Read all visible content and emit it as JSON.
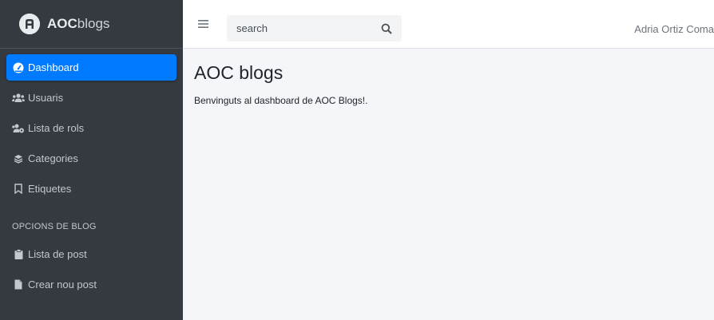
{
  "brand": {
    "bold": "AOC",
    "light": "blogs"
  },
  "sidebar": {
    "items": [
      {
        "label": "Dashboard",
        "icon": "tachometer-icon",
        "active": true
      },
      {
        "label": "Usuaris",
        "icon": "users-icon"
      },
      {
        "label": "Lista de rols",
        "icon": "users-cog-icon"
      },
      {
        "label": "Categories",
        "icon": "layers-icon"
      },
      {
        "label": "Etiquetes",
        "icon": "bookmark-icon"
      }
    ],
    "header": "OPCIONS DE BLOG",
    "blog_items": [
      {
        "label": "Lista de post",
        "icon": "clipboard-icon"
      },
      {
        "label": "Crear nou post",
        "icon": "file-icon"
      }
    ]
  },
  "topbar": {
    "search_placeholder": "search",
    "search_value": "",
    "user_name": "Adria Ortiz Coma"
  },
  "main": {
    "title": "AOC blogs",
    "text": "Benvinguts al dashboard de AOC Blogs!."
  },
  "colors": {
    "sidebar_bg": "#343a40",
    "accent": "#007bff",
    "content_bg": "#f4f6f9"
  }
}
